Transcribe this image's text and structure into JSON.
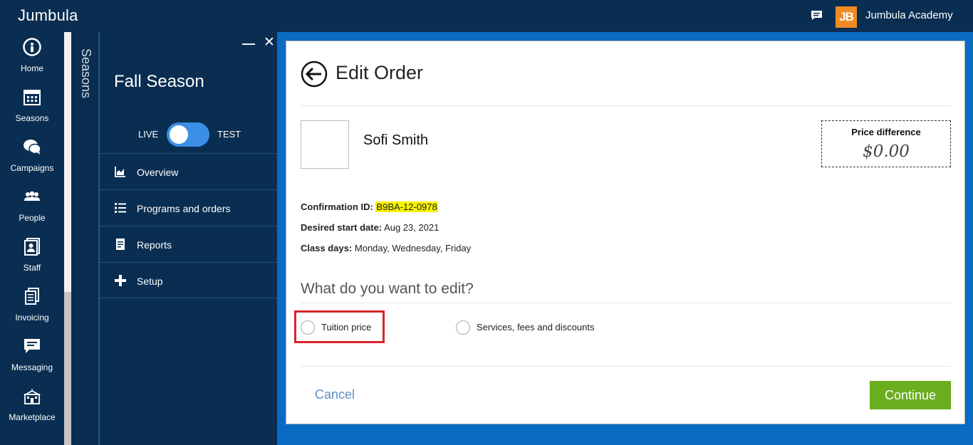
{
  "topbar": {
    "brand": "Jumbula",
    "chat_icon": "chat-icon",
    "logo_text": "JB",
    "logo_color": "#f08a24",
    "org_name": "Jumbula Academy"
  },
  "leftnav": {
    "items": [
      {
        "label": "Home",
        "icon": "home-icon"
      },
      {
        "label": "Seasons",
        "icon": "calendar-icon"
      },
      {
        "label": "Campaigns",
        "icon": "speech-bubbles-icon"
      },
      {
        "label": "People",
        "icon": "people-icon"
      },
      {
        "label": "Staff",
        "icon": "staff-badge-icon"
      },
      {
        "label": "Invoicing",
        "icon": "invoice-icon"
      },
      {
        "label": "Messaging",
        "icon": "message-icon"
      },
      {
        "label": "Marketplace",
        "icon": "marketplace-icon"
      }
    ]
  },
  "seasons_strip": {
    "label": "Seasons"
  },
  "season_panel": {
    "title": "Fall Season",
    "toggle": {
      "left_label": "LIVE",
      "right_label": "TEST"
    },
    "menu": [
      {
        "label": "Overview",
        "icon": "chart-icon"
      },
      {
        "label": "Programs and orders",
        "icon": "list-icon"
      },
      {
        "label": "Reports",
        "icon": "report-icon"
      },
      {
        "label": "Setup",
        "icon": "plus-icon"
      }
    ]
  },
  "order": {
    "title": "Edit Order",
    "person_name": "Sofi Smith",
    "price_difference": {
      "label": "Price difference",
      "value": "$0.00"
    },
    "confirmation": {
      "label": "Confirmation ID:",
      "value": "B9BA-12-0978"
    },
    "start_date": {
      "label": "Desired start date:",
      "value": "Aug 23, 2021"
    },
    "class_days": {
      "label": "Class days:",
      "value": "Monday, Wednesday, Friday"
    },
    "question": "What do you want to edit?",
    "options": [
      {
        "label": "Tuition price"
      },
      {
        "label": "Services, fees and discounts"
      }
    ],
    "cancel_label": "Cancel",
    "continue_label": "Continue",
    "continue_color": "#6aad1f",
    "highlight_color": "#d9232e"
  }
}
